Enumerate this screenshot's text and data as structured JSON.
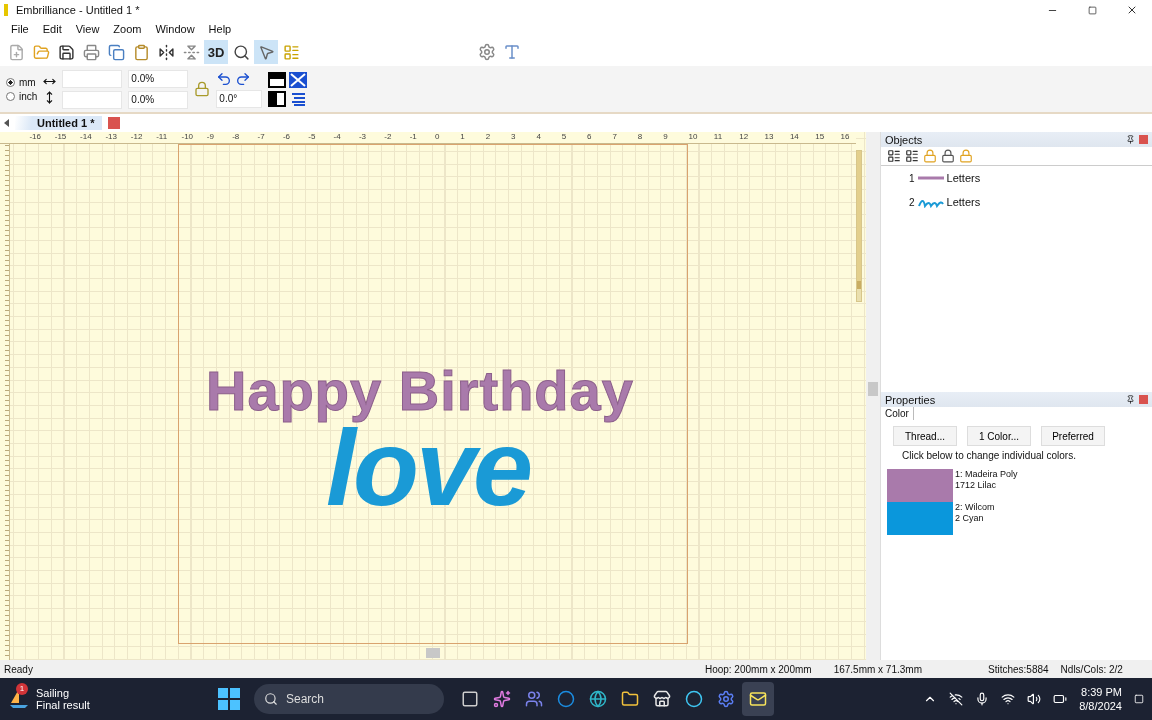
{
  "window": {
    "title": "Embrilliance -  Untitled 1 *"
  },
  "menu": [
    "File",
    "Edit",
    "View",
    "Zoom",
    "Window",
    "Help"
  ],
  "toolbar": [
    {
      "pressed": false
    },
    {
      "pressed": false
    },
    {
      "pressed": false
    },
    {
      "pressed": false
    },
    {
      "pressed": false
    },
    {
      "pressed": false
    },
    {
      "pressed": false
    },
    {
      "pressed": false
    },
    {
      "label": "3D",
      "pressed": true
    },
    {
      "pressed": false
    },
    {
      "pressed": true
    },
    {
      "pressed": false
    }
  ],
  "units": [
    {
      "label": "mm",
      "selected": true
    },
    {
      "label": "inch",
      "selected": false
    }
  ],
  "transform": {
    "width_scale": "0.0%",
    "height_scale": "0.0%",
    "rotation": "0.0°"
  },
  "tab": {
    "label": "Untitled 1 *",
    "selected": true
  },
  "ruler": [
    "-16",
    "-15",
    "-14",
    "-13",
    "-12",
    "-11",
    "-10",
    "-9",
    "-8",
    "-7",
    "-6",
    "-5",
    "-4",
    "-3",
    "-2",
    "-1",
    "0",
    "1",
    "2",
    "3",
    "4",
    "5",
    "6",
    "7",
    "8",
    "9",
    "10",
    "11",
    "12",
    "13",
    "14",
    "15",
    "16"
  ],
  "zoom": {
    "level": 0.92
  },
  "design": [
    {
      "kind": "block",
      "text": "Happy Birthday",
      "color": "#a97aab"
    },
    {
      "kind": "script",
      "text": "love",
      "color": "#1a9ad6"
    }
  ],
  "objects": {
    "title": "Objects",
    "items": [
      {
        "number": "1",
        "label": "Letters"
      },
      {
        "number": "2",
        "label": "Letters"
      }
    ]
  },
  "properties": {
    "title": "Properties",
    "tab": "Color",
    "buttons": [
      "Thread...",
      "1 Color...",
      "Preferred"
    ],
    "hint": "Click below to change individual colors.",
    "colors": [
      {
        "line1": "1: Madeira Poly",
        "line2": "1712 Lilac",
        "color": "#a97aab"
      },
      {
        "line1": "2: Wilcom",
        "line2": "2 Cyan",
        "color": "#0a97dc"
      }
    ]
  },
  "status": [
    "Ready",
    "Hoop: 200mm x 200mm",
    "167.5mm x 71.3mm",
    "Stitches:5884",
    "Ndls/Cols: 2/2"
  ],
  "taskbar": {
    "widget": {
      "badge": "1",
      "title": "Sailing",
      "subtitle": "Final result"
    },
    "search": {
      "placeholder": "Search"
    },
    "apps": [
      {
        "selected": false
      },
      {
        "selected": false
      },
      {
        "selected": false
      },
      {
        "selected": false
      },
      {
        "selected": false
      },
      {
        "selected": false
      },
      {
        "selected": false
      },
      {
        "selected": false
      },
      {
        "selected": false
      },
      {
        "selected": true
      }
    ],
    "time": "8:39 PM",
    "date": "8/8/2024"
  }
}
